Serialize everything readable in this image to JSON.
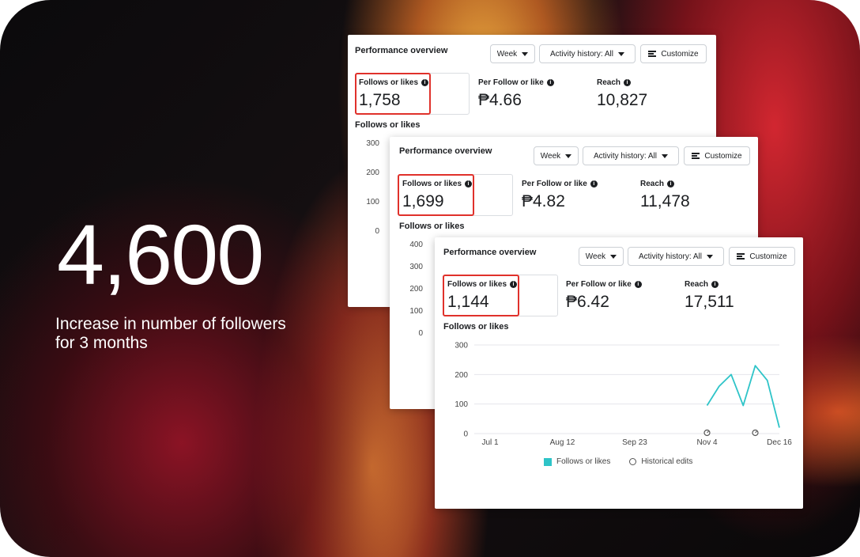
{
  "headline": {
    "number": "4,600",
    "caption_line1": "Increase in number of followers",
    "caption_line2": "for 3 months"
  },
  "cards": [
    {
      "title": "Performance overview",
      "week": "Week",
      "activity": "Activity history: All",
      "customize": "Customize",
      "metrics": [
        {
          "label": "Follows or likes",
          "value": "1,758"
        },
        {
          "label": "Per Follow or like",
          "value": "₱4.66"
        },
        {
          "label": "Reach",
          "value": "10,827"
        }
      ],
      "subheading": "Follows or likes",
      "yticks": [
        "300",
        "200",
        "100",
        "0"
      ]
    },
    {
      "title": "Performance overview",
      "week": "Week",
      "activity": "Activity history: All",
      "customize": "Customize",
      "metrics": [
        {
          "label": "Follows or likes",
          "value": "1,699"
        },
        {
          "label": "Per Follow or like",
          "value": "₱4.82"
        },
        {
          "label": "Reach",
          "value": "11,478"
        }
      ],
      "subheading": "Follows or likes",
      "yticks": [
        "400",
        "300",
        "200",
        "100",
        "0"
      ]
    },
    {
      "title": "Performance overview",
      "week": "Week",
      "activity": "Activity history: All",
      "customize": "Customize",
      "metrics": [
        {
          "label": "Follows or likes",
          "value": "1,144"
        },
        {
          "label": "Per Follow or like",
          "value": "₱6.42"
        },
        {
          "label": "Reach",
          "value": "17,511"
        }
      ],
      "subheading": "Follows or likes",
      "legend_series": "Follows or likes",
      "legend_edits": "Historical edits"
    }
  ],
  "chart_data": {
    "type": "line",
    "title": "Follows or likes",
    "x_ticks": [
      "Jul 1",
      "Aug 12",
      "Sep 23",
      "Nov 4",
      "Dec 16"
    ],
    "y_ticks": [
      0,
      100,
      200,
      300
    ],
    "ylim": [
      0,
      300
    ],
    "grid": true,
    "legend_placement": "bottom",
    "series": [
      {
        "name": "Follows or likes",
        "color": "#2ec4c8",
        "x": [
          "Nov 4",
          "Nov 11",
          "Nov 18",
          "Nov 25",
          "Dec 2",
          "Dec 9",
          "Dec 16"
        ],
        "values": [
          95,
          160,
          200,
          95,
          230,
          180,
          20
        ]
      }
    ],
    "historical_edits_at": [
      "Nov 4",
      "Dec 2"
    ]
  },
  "colors": {
    "highlight": "#e0312b",
    "series": "#2ec4c8"
  }
}
